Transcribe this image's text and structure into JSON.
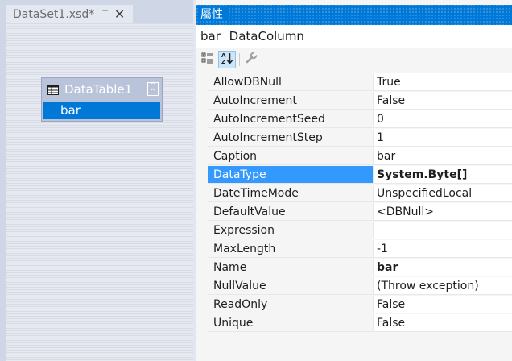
{
  "document_tab": {
    "title": "DataSet1.xsd*",
    "pin_glyph": "⍑",
    "close_glyph": "✕"
  },
  "datatable": {
    "title": "DataTable1",
    "collapse_glyph": "˄",
    "columns": [
      {
        "name": "bar"
      }
    ]
  },
  "properties_panel": {
    "title": "屬性",
    "object_name": "bar",
    "object_type": "DataColumn",
    "toolbar": {
      "categorized_icon": "categorized-icon",
      "alphabetical_icon": "alphabetical-icon",
      "property_pages_icon": "wrench-icon"
    },
    "selected_property": "DataType",
    "rows": [
      {
        "name": "AllowDBNull",
        "value": "True"
      },
      {
        "name": "AutoIncrement",
        "value": "False"
      },
      {
        "name": "AutoIncrementSeed",
        "value": "0"
      },
      {
        "name": "AutoIncrementStep",
        "value": "1"
      },
      {
        "name": "Caption",
        "value": "bar"
      },
      {
        "name": "DataType",
        "value": "System.Byte[]"
      },
      {
        "name": "DateTimeMode",
        "value": "UnspecifiedLocal"
      },
      {
        "name": "DefaultValue",
        "value": "<DBNull>"
      },
      {
        "name": "Expression",
        "value": ""
      },
      {
        "name": "MaxLength",
        "value": "-1"
      },
      {
        "name": "Name",
        "value": "bar"
      },
      {
        "name": "NullValue",
        "value": "(Throw exception)"
      },
      {
        "name": "ReadOnly",
        "value": "False"
      },
      {
        "name": "Unique",
        "value": "False"
      }
    ],
    "bold_values": [
      "DataType",
      "Name"
    ]
  },
  "colors": {
    "accent": "#0078d7",
    "selection": "#3399ff",
    "designer_bg": "#e6e9f0",
    "table_header": "#b9c4da"
  }
}
